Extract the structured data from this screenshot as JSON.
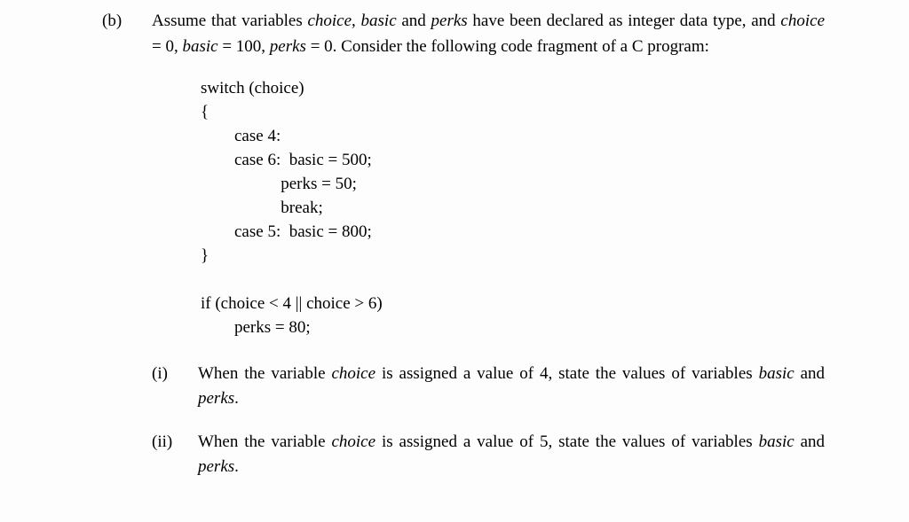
{
  "question": {
    "label": "(b)",
    "intro_pre": "Assume that variables ",
    "intro_var1": "choice",
    "intro_mid1": ", ",
    "intro_var2": "basic",
    "intro_mid2": " and ",
    "intro_var3": "perks",
    "intro_mid3": " have been declared as integer data type, and ",
    "intro_var4": "choice",
    "intro_mid4": " = 0, ",
    "intro_var5": "basic",
    "intro_mid5": " = 100, ",
    "intro_var6": "perks",
    "intro_mid6": " = 0. Consider the following code fragment of a C program:",
    "code": "switch (choice)\n{\n        case 4:\n        case 6:  basic = 500;\n                   perks = 50;\n                   break;\n        case 5:  basic = 800;\n}\n\nif (choice < 4 || choice > 6)\n        perks = 80;",
    "sub": [
      {
        "label": "(i)",
        "pre": "When the variable ",
        "var1": "choice",
        "mid1": " is assigned a value of 4, state the values of variables ",
        "var2": "basic",
        "mid2": " and ",
        "var3": "perks",
        "post": "."
      },
      {
        "label": "(ii)",
        "pre": "When the variable ",
        "var1": "choice",
        "mid1": " is assigned a value of 5, state the values of variables ",
        "var2": "basic",
        "mid2": " and ",
        "var3": "perks",
        "post": "."
      }
    ]
  }
}
